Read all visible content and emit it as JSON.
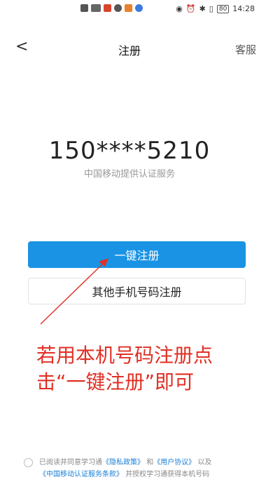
{
  "status": {
    "time": "14:28",
    "battery": "80",
    "left_icon_colors": [
      "#555555",
      "#666666",
      "#d9452b",
      "#555555",
      "#e8812a",
      "#3a7be0"
    ]
  },
  "header": {
    "back_icon": "<",
    "title": "注册",
    "service": "客服"
  },
  "main": {
    "phone": "150****5210",
    "provider": "中国移动提供认证服务",
    "primary_button": "一键注册",
    "secondary_button": "其他手机号码注册"
  },
  "annotation": {
    "line1": "若用本机号码注册点",
    "line2": "击“一键注册”即可",
    "color": "#e03025"
  },
  "agreement": {
    "prefix": "已阅读并同意学习通",
    "privacy": "《隐私政策》",
    "and": "和",
    "user": "《用户协议》",
    "also": "以及",
    "cmcc_terms": "《中国移动认证服务条款》",
    "suffix": "并授权学习通获得本机号码"
  },
  "colors": {
    "primary": "#1a93e4",
    "link": "#1a7fd6"
  }
}
